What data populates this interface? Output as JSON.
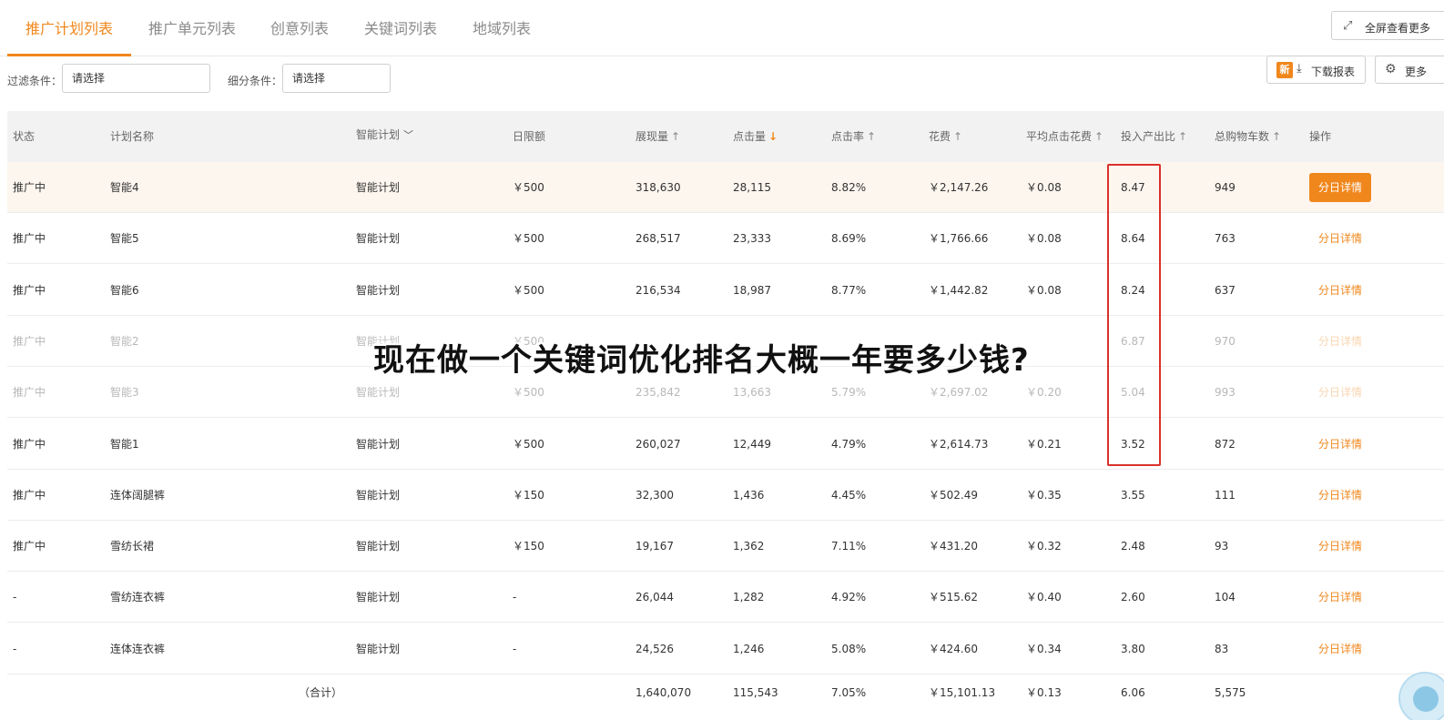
{
  "tabs": [
    {
      "label": "推广计划列表",
      "active": true
    },
    {
      "label": "推广单元列表",
      "active": false
    },
    {
      "label": "创意列表",
      "active": false
    },
    {
      "label": "关键词列表",
      "active": false
    },
    {
      "label": "地域列表",
      "active": false
    }
  ],
  "toolbar": {
    "fullscreen_label": "全屏查看更多",
    "download_badge": "新",
    "download_label": "下载报表",
    "more_label": "更多"
  },
  "filters": {
    "filter_label": "过滤条件：",
    "filter_placeholder": "请选择",
    "segment_label": "细分条件：",
    "segment_placeholder": "请选择"
  },
  "table": {
    "headers": {
      "status": "状态",
      "name": "计划名称",
      "type": "智能计划",
      "budget": "日限额",
      "impressions": "展现量",
      "clicks": "点击量",
      "ctr": "点击率",
      "cost": "花费",
      "cpc": "平均点击花费",
      "roi": "投入产出比",
      "carts": "总购物车数",
      "action": "操作"
    },
    "rows": [
      {
        "status": "推广中",
        "name": "智能4",
        "type": "智能计划",
        "budget": "￥500",
        "impressions": "318,630",
        "clicks": "28,115",
        "ctr": "8.82%",
        "cost": "￥2,147.26",
        "cpc": "￥0.08",
        "roi": "8.47",
        "carts": "949",
        "action": "分日详情"
      },
      {
        "status": "推广中",
        "name": "智能5",
        "type": "智能计划",
        "budget": "￥500",
        "impressions": "268,517",
        "clicks": "23,333",
        "ctr": "8.69%",
        "cost": "￥1,766.66",
        "cpc": "￥0.08",
        "roi": "8.64",
        "carts": "763",
        "action": "分日详情"
      },
      {
        "status": "推广中",
        "name": "智能6",
        "type": "智能计划",
        "budget": "￥500",
        "impressions": "216,534",
        "clicks": "18,987",
        "ctr": "8.77%",
        "cost": "￥1,442.82",
        "cpc": "￥0.08",
        "roi": "8.24",
        "carts": "637",
        "action": "分日详情"
      },
      {
        "status": "推广中",
        "name": "智能2",
        "type": "智能计划",
        "budget": "￥500",
        "impressions": "",
        "clicks": "",
        "ctr": "",
        "cost": "",
        "cpc": "",
        "roi": "6.87",
        "carts": "970",
        "action": "分日详情"
      },
      {
        "status": "推广中",
        "name": "智能3",
        "type": "智能计划",
        "budget": "￥500",
        "impressions": "235,842",
        "clicks": "13,663",
        "ctr": "5.79%",
        "cost": "￥2,697.02",
        "cpc": "￥0.20",
        "roi": "5.04",
        "carts": "993",
        "action": "分日详情"
      },
      {
        "status": "推广中",
        "name": "智能1",
        "type": "智能计划",
        "budget": "￥500",
        "impressions": "260,027",
        "clicks": "12,449",
        "ctr": "4.79%",
        "cost": "￥2,614.73",
        "cpc": "￥0.21",
        "roi": "3.52",
        "carts": "872",
        "action": "分日详情"
      },
      {
        "status": "推广中",
        "name": "连体阔腿裤",
        "type": "智能计划",
        "budget": "￥150",
        "impressions": "32,300",
        "clicks": "1,436",
        "ctr": "4.45%",
        "cost": "￥502.49",
        "cpc": "￥0.35",
        "roi": "3.55",
        "carts": "111",
        "action": "分日详情"
      },
      {
        "status": "推广中",
        "name": "雪纺长裙",
        "type": "智能计划",
        "budget": "￥150",
        "impressions": "19,167",
        "clicks": "1,362",
        "ctr": "7.11%",
        "cost": "￥431.20",
        "cpc": "￥0.32",
        "roi": "2.48",
        "carts": "93",
        "action": "分日详情"
      },
      {
        "status": "-",
        "name": "雪纺连衣裤",
        "type": "智能计划",
        "budget": "-",
        "impressions": "26,044",
        "clicks": "1,282",
        "ctr": "4.92%",
        "cost": "￥515.62",
        "cpc": "￥0.40",
        "roi": "2.60",
        "carts": "104",
        "action": "分日详情"
      },
      {
        "status": "-",
        "name": "连体连衣裤",
        "type": "智能计划",
        "budget": "-",
        "impressions": "24,526",
        "clicks": "1,246",
        "ctr": "5.08%",
        "cost": "￥424.60",
        "cpc": "￥0.34",
        "roi": "3.80",
        "carts": "83",
        "action": "分日详情"
      }
    ],
    "total": {
      "label": "（合计）",
      "impressions": "1,640,070",
      "clicks": "115,543",
      "ctr": "7.05%",
      "cost": "￥15,101.13",
      "cpc": "￥0.13",
      "roi": "6.06",
      "carts": "5,575"
    }
  },
  "overlay": {
    "headline": "现在做一个关键词优化排名大概一年要多少钱?"
  },
  "colors": {
    "accent": "#f0871c",
    "highlight_box": "#d9312b",
    "highlight_row": "#fdf6ef",
    "header_bg": "#f2f2f2"
  }
}
